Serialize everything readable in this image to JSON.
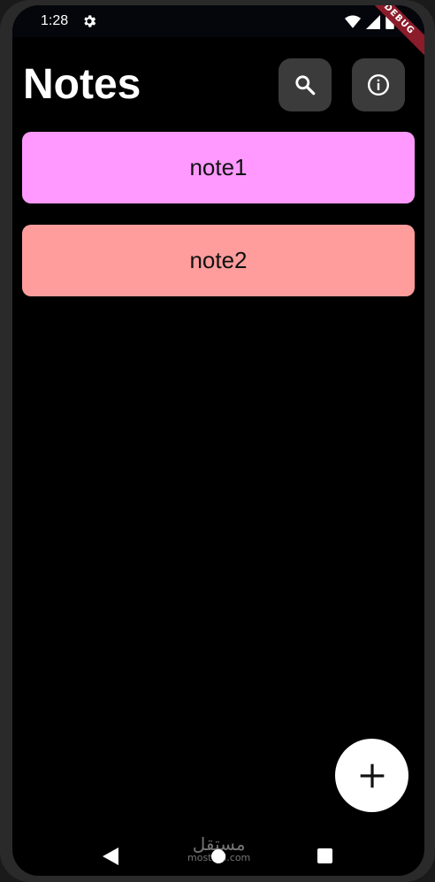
{
  "status_bar": {
    "time": "1:28",
    "debug_label": "DEBUG"
  },
  "header": {
    "title": "Notes"
  },
  "notes": [
    {
      "title": "note1",
      "color": "#ff99ff"
    },
    {
      "title": "note2",
      "color": "#ff9c9c"
    }
  ],
  "icons": {
    "search": "search-icon",
    "info": "info-icon",
    "add": "plus-icon",
    "settings": "gear-icon",
    "wifi": "wifi-icon",
    "signal": "signal-icon",
    "battery": "battery-icon",
    "back": "back-triangle-icon",
    "home": "home-circle-icon",
    "recents": "recents-square-icon"
  },
  "watermark": {
    "arabic": "مستقل",
    "latin": "mostaql.com"
  },
  "colors": {
    "background": "#000000",
    "icon_button": "#3b3b3b",
    "fab": "#ffffff",
    "debug_banner": "#8b1c2a"
  }
}
